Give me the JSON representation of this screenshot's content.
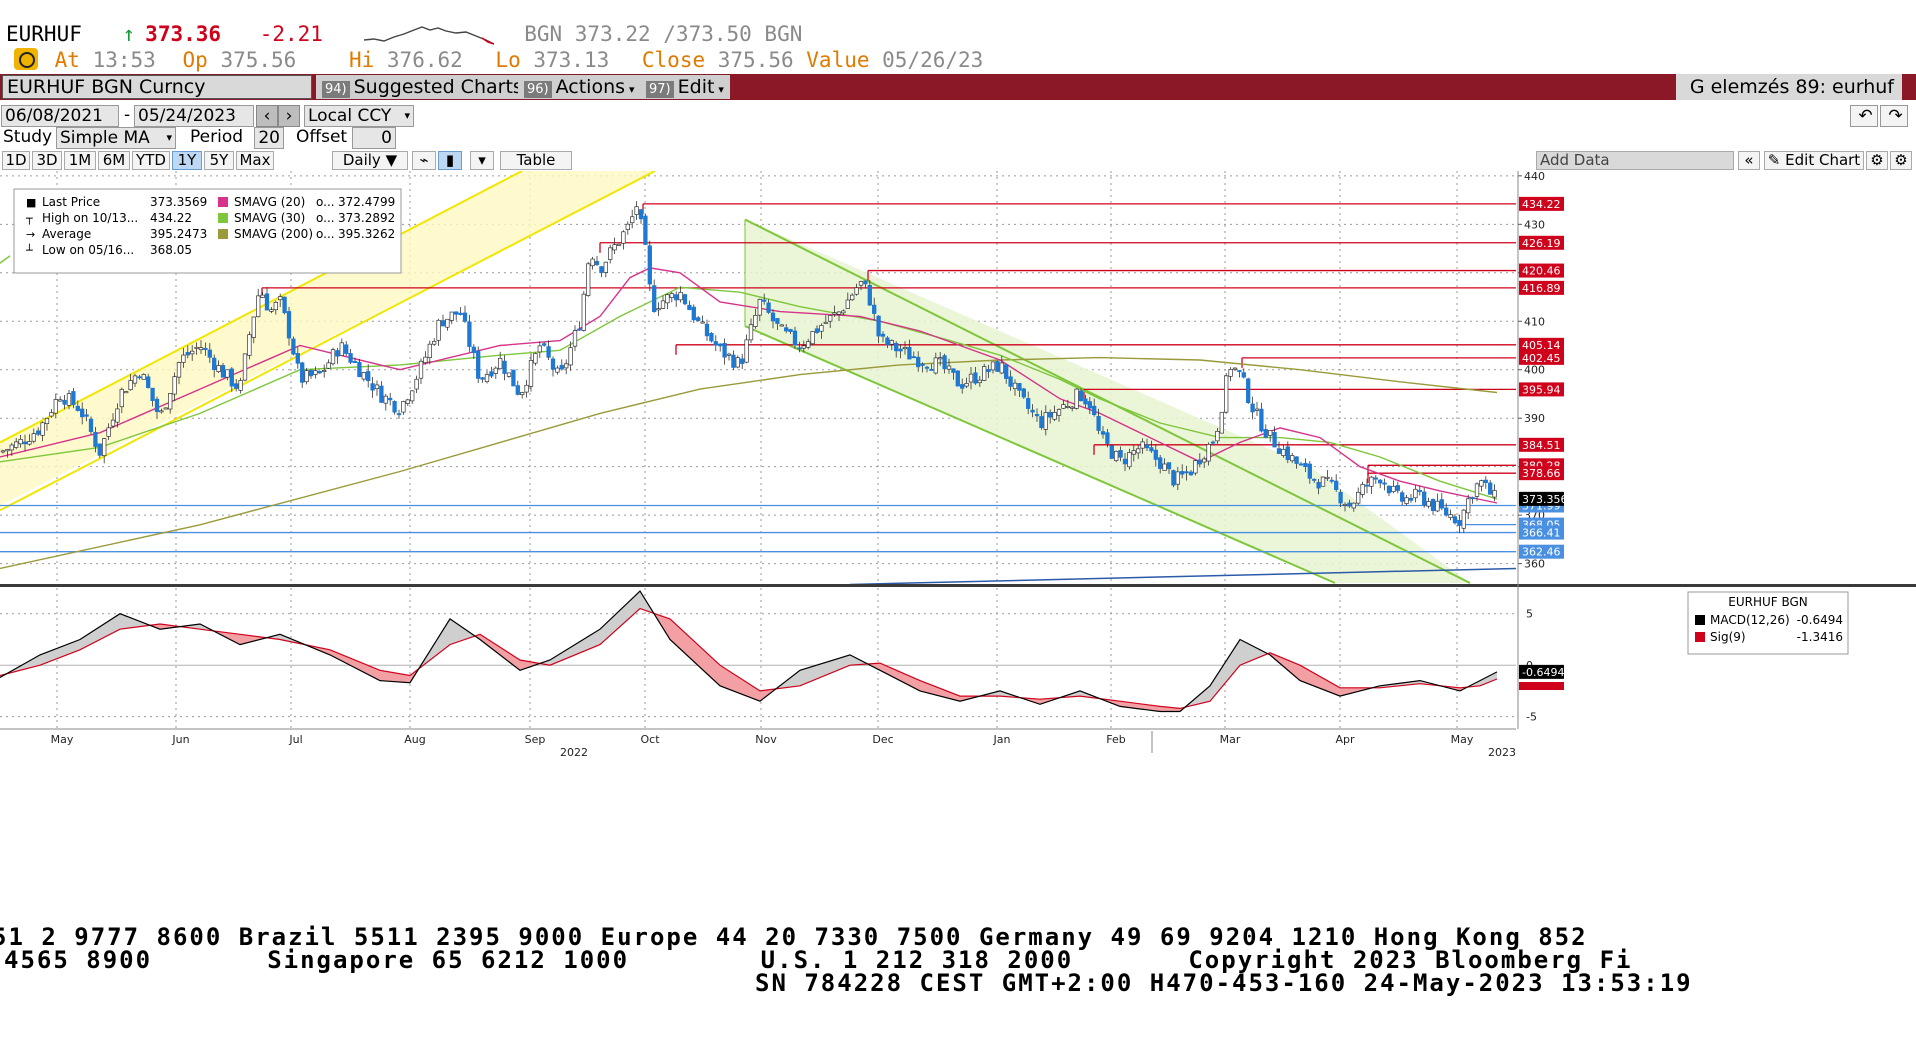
{
  "header": {
    "ticker": "EURHUF",
    "arrow": "↑",
    "last": "373.36",
    "change": "-2.21",
    "bid_ask": "BGN 373.22 /373.50 BGN",
    "at_label": "At",
    "at_time": "13:53",
    "open_label": "Op",
    "open": "375.56",
    "high_label": "Hi",
    "high": "376.62",
    "low_label": "Lo",
    "low": "373.13",
    "close_label": "Close",
    "close": "375.56",
    "value_label": "Value",
    "value_date": "05/26/23"
  },
  "toolbar": {
    "security": "EURHUF BGN Curncy",
    "suggested_num": "94)",
    "suggested": "Suggested Charts",
    "actions_num": "96)",
    "actions": "Actions",
    "edit_num": "97)",
    "edit": "Edit",
    "right_title": "G elemzés 89: eurhuf"
  },
  "controls": {
    "start_date": "06/08/2021",
    "end_date": "05/24/2023",
    "dash": "-",
    "currency": "Local CCY",
    "study_label": "Study",
    "study": "Simple MA",
    "period_label": "Period",
    "period": "20",
    "offset_label": "Offset",
    "offset": "0",
    "ranges": [
      "1D",
      "3D",
      "1M",
      "6M",
      "YTD",
      "1Y",
      "5Y",
      "Max"
    ],
    "selected_range": "1Y",
    "frequency": "Daily",
    "table": "Table",
    "add_data": "Add Data",
    "edit_chart": "Edit Chart"
  },
  "legend": {
    "rows": [
      {
        "label": "Last Price",
        "value": "373.3569"
      },
      {
        "label": "High on 10/13...",
        "value": "434.22"
      },
      {
        "label": "Average",
        "value": "395.2473"
      },
      {
        "label": "Low on 05/16...",
        "value": "368.05"
      }
    ],
    "sma_rows": [
      {
        "label": "SMAVG (20)",
        "mid": "o...",
        "value": "372.4799",
        "color": "#d6338a"
      },
      {
        "label": "SMAVG (30)",
        "mid": "o...",
        "value": "373.2892",
        "color": "#7ec63a"
      },
      {
        "label": "SMAVG (200)",
        "mid": "o...",
        "value": "395.3262",
        "color": "#9a9a3a"
      }
    ]
  },
  "macd_legend": {
    "title": "EURHUF BGN",
    "macd_label": "MACD(12,26)",
    "macd_value": "-0.6494",
    "sig_label": "Sig(9)",
    "sig_value": "-1.3416",
    "last_tag": "-0.6494"
  },
  "chart_data": {
    "type": "candlestick",
    "price_axis": {
      "ylim": [
        356,
        441
      ],
      "ticks": [
        360,
        370,
        380,
        390,
        400,
        410,
        420,
        430,
        440
      ]
    },
    "macd_axis": {
      "ylim": [
        -6.2,
        7.5
      ],
      "ticks": [
        -5,
        0,
        5
      ]
    },
    "x_months": [
      "May",
      "Jun",
      "Jul",
      "Aug",
      "Sep",
      "Oct",
      "Nov",
      "Dec",
      "Jan",
      "Feb",
      "Mar",
      "Apr",
      "May"
    ],
    "year_labels": [
      "2022",
      "2023"
    ],
    "price_path": [
      [
        0,
        383
      ],
      [
        20,
        385
      ],
      [
        40,
        388
      ],
      [
        60,
        395
      ],
      [
        80,
        392
      ],
      [
        100,
        383
      ],
      [
        120,
        395
      ],
      [
        140,
        400
      ],
      [
        160,
        390
      ],
      [
        180,
        402
      ],
      [
        200,
        405
      ],
      [
        220,
        400
      ],
      [
        240,
        396
      ],
      [
        250,
        408
      ],
      [
        260,
        417
      ],
      [
        270,
        412
      ],
      [
        280,
        414
      ],
      [
        290,
        407
      ],
      [
        300,
        398
      ],
      [
        320,
        399
      ],
      [
        340,
        405
      ],
      [
        360,
        400
      ],
      [
        380,
        395
      ],
      [
        400,
        392
      ],
      [
        420,
        400
      ],
      [
        440,
        410
      ],
      [
        460,
        412
      ],
      [
        480,
        398
      ],
      [
        500,
        402
      ],
      [
        520,
        395
      ],
      [
        540,
        405
      ],
      [
        560,
        398
      ],
      [
        580,
        410
      ],
      [
        590,
        425
      ],
      [
        600,
        421
      ],
      [
        620,
        427
      ],
      [
        630,
        430
      ],
      [
        637,
        434.2
      ],
      [
        645,
        425
      ],
      [
        652,
        413
      ],
      [
        660,
        414
      ],
      [
        680,
        416
      ],
      [
        700,
        409
      ],
      [
        720,
        404
      ],
      [
        740,
        401
      ],
      [
        760,
        414
      ],
      [
        780,
        408
      ],
      [
        800,
        405
      ],
      [
        820,
        409
      ],
      [
        840,
        412
      ],
      [
        860,
        418
      ],
      [
        868,
        416
      ],
      [
        880,
        406
      ],
      [
        900,
        404
      ],
      [
        920,
        402
      ],
      [
        940,
        401
      ],
      [
        960,
        397
      ],
      [
        980,
        399
      ],
      [
        1000,
        401
      ],
      [
        1020,
        394
      ],
      [
        1040,
        389
      ],
      [
        1060,
        392
      ],
      [
        1080,
        395
      ],
      [
        1090,
        393
      ],
      [
        1100,
        386
      ],
      [
        1120,
        381
      ],
      [
        1140,
        384
      ],
      [
        1160,
        381
      ],
      [
        1175,
        377
      ],
      [
        1190,
        379
      ],
      [
        1200,
        382
      ],
      [
        1215,
        386
      ],
      [
        1230,
        401
      ],
      [
        1240,
        399
      ],
      [
        1255,
        391
      ],
      [
        1270,
        386
      ],
      [
        1290,
        382
      ],
      [
        1310,
        378
      ],
      [
        1330,
        376
      ],
      [
        1350,
        372
      ],
      [
        1365,
        376
      ],
      [
        1380,
        378
      ],
      [
        1400,
        373
      ],
      [
        1420,
        374
      ],
      [
        1440,
        371
      ],
      [
        1460,
        369
      ],
      [
        1470,
        374
      ],
      [
        1480,
        377
      ],
      [
        1495,
        373.4
      ]
    ],
    "sma20": [
      [
        0,
        382
      ],
      [
        100,
        387
      ],
      [
        200,
        396
      ],
      [
        300,
        405
      ],
      [
        400,
        400
      ],
      [
        500,
        405
      ],
      [
        560,
        406
      ],
      [
        600,
        411
      ],
      [
        630,
        419
      ],
      [
        650,
        421
      ],
      [
        680,
        420
      ],
      [
        720,
        414
      ],
      [
        780,
        412
      ],
      [
        860,
        411
      ],
      [
        920,
        408
      ],
      [
        1000,
        402
      ],
      [
        1060,
        394
      ],
      [
        1100,
        391
      ],
      [
        1150,
        386
      ],
      [
        1200,
        381
      ],
      [
        1240,
        385
      ],
      [
        1280,
        388
      ],
      [
        1320,
        386
      ],
      [
        1360,
        380
      ],
      [
        1400,
        377
      ],
      [
        1440,
        375
      ],
      [
        1497,
        372.5
      ]
    ],
    "sma30": [
      [
        0,
        381
      ],
      [
        100,
        384
      ],
      [
        200,
        391
      ],
      [
        300,
        400
      ],
      [
        400,
        401
      ],
      [
        500,
        403
      ],
      [
        560,
        404
      ],
      [
        620,
        411
      ],
      [
        680,
        417
      ],
      [
        740,
        416
      ],
      [
        800,
        413
      ],
      [
        880,
        410
      ],
      [
        950,
        406
      ],
      [
        1000,
        403
      ],
      [
        1060,
        398
      ],
      [
        1100,
        394
      ],
      [
        1160,
        389
      ],
      [
        1220,
        386
      ],
      [
        1280,
        386
      ],
      [
        1330,
        385
      ],
      [
        1380,
        382
      ],
      [
        1440,
        377
      ],
      [
        1497,
        373.3
      ]
    ],
    "sma200": [
      [
        0,
        359
      ],
      [
        200,
        368
      ],
      [
        400,
        379
      ],
      [
        600,
        391
      ],
      [
        700,
        396
      ],
      [
        800,
        399
      ],
      [
        900,
        401
      ],
      [
        1000,
        402
      ],
      [
        1100,
        402.5
      ],
      [
        1200,
        402
      ],
      [
        1300,
        400
      ],
      [
        1400,
        397.5
      ],
      [
        1497,
        395.3
      ]
    ],
    "macd": [
      [
        0,
        -1.2
      ],
      [
        40,
        1
      ],
      [
        80,
        2.5
      ],
      [
        120,
        5
      ],
      [
        160,
        3.5
      ],
      [
        200,
        4
      ],
      [
        240,
        2
      ],
      [
        280,
        3
      ],
      [
        330,
        1
      ],
      [
        380,
        -1.5
      ],
      [
        410,
        -1.7
      ],
      [
        450,
        4.5
      ],
      [
        480,
        2.5
      ],
      [
        520,
        -0.5
      ],
      [
        550,
        0.5
      ],
      [
        600,
        3.5
      ],
      [
        640,
        7.2
      ],
      [
        670,
        2.5
      ],
      [
        720,
        -2
      ],
      [
        760,
        -3.5
      ],
      [
        800,
        -0.5
      ],
      [
        850,
        1
      ],
      [
        880,
        -0.5
      ],
      [
        920,
        -2.5
      ],
      [
        960,
        -3.5
      ],
      [
        1000,
        -2.5
      ],
      [
        1040,
        -3.8
      ],
      [
        1080,
        -2.5
      ],
      [
        1120,
        -4
      ],
      [
        1160,
        -4.5
      ],
      [
        1180,
        -4.5
      ],
      [
        1210,
        -2
      ],
      [
        1240,
        2.5
      ],
      [
        1270,
        1
      ],
      [
        1300,
        -1.5
      ],
      [
        1340,
        -3
      ],
      [
        1380,
        -2
      ],
      [
        1420,
        -1.5
      ],
      [
        1460,
        -2.5
      ],
      [
        1480,
        -1.5
      ],
      [
        1497,
        -0.65
      ]
    ],
    "signal": [
      [
        0,
        -1
      ],
      [
        40,
        0
      ],
      [
        80,
        1.5
      ],
      [
        120,
        3.5
      ],
      [
        160,
        4
      ],
      [
        200,
        3.5
      ],
      [
        240,
        3
      ],
      [
        280,
        2.5
      ],
      [
        330,
        1.5
      ],
      [
        380,
        -0.5
      ],
      [
        410,
        -1
      ],
      [
        450,
        2
      ],
      [
        480,
        3
      ],
      [
        520,
        0.5
      ],
      [
        550,
        0
      ],
      [
        600,
        2
      ],
      [
        640,
        5.5
      ],
      [
        670,
        4.5
      ],
      [
        720,
        0
      ],
      [
        760,
        -2.5
      ],
      [
        800,
        -2
      ],
      [
        850,
        0
      ],
      [
        880,
        0.2
      ],
      [
        920,
        -1.5
      ],
      [
        960,
        -3
      ],
      [
        1000,
        -3
      ],
      [
        1040,
        -3.3
      ],
      [
        1080,
        -3
      ],
      [
        1120,
        -3.5
      ],
      [
        1160,
        -4
      ],
      [
        1180,
        -4.2
      ],
      [
        1210,
        -3.5
      ],
      [
        1240,
        0
      ],
      [
        1270,
        1.2
      ],
      [
        1300,
        0
      ],
      [
        1340,
        -2.2
      ],
      [
        1380,
        -2.2
      ],
      [
        1420,
        -1.8
      ],
      [
        1460,
        -2.2
      ],
      [
        1480,
        -2
      ],
      [
        1497,
        -1.34
      ]
    ],
    "horizontal_levels": [
      {
        "value": 434.22,
        "label": "434.22",
        "color": "#d0021b",
        "x_from": 643
      },
      {
        "value": 426.19,
        "label": "426.19",
        "color": "#d0021b",
        "x_from": 600
      },
      {
        "value": 420.46,
        "label": "420.46",
        "color": "#d0021b",
        "x_from": 868
      },
      {
        "value": 416.89,
        "label": "416.89",
        "color": "#d0021b",
        "x_from": 262
      },
      {
        "value": 405.14,
        "label": "405.14",
        "color": "#d0021b",
        "x_from": 676
      },
      {
        "value": 402.45,
        "label": "402.45",
        "color": "#d0021b",
        "x_from": 1242
      },
      {
        "value": 395.94,
        "label": "395.94",
        "color": "#d0021b",
        "x_from": 1084
      },
      {
        "value": 384.51,
        "label": "384.51",
        "color": "#d0021b",
        "x_from": 1094
      },
      {
        "value": 380.28,
        "label": "380.28",
        "color": "#d0021b",
        "x_from": 1368
      },
      {
        "value": 378.66,
        "label": "378.66",
        "color": "#d0021b",
        "x_from": 1368
      },
      {
        "value": 371.99,
        "label": "371.99",
        "color": "#4a90e2",
        "x_from": 0
      },
      {
        "value": 368.05,
        "label": "368.05",
        "color": "#4a90e2",
        "x_from": 1465
      },
      {
        "value": 366.41,
        "label": "366.41",
        "color": "#4a90e2",
        "x_from": 0
      },
      {
        "value": 362.46,
        "label": "362.46",
        "color": "#4a90e2",
        "x_from": 0
      }
    ],
    "last_price_tag": "373.3569"
  },
  "tape": {
    "line1": "51 2 9777 8600 Brazil 5511 2395 9000 Europe 44 20 7330 7500 Germany 49 69 9204 1210 Hong Kong 852",
    "line2": "4565 8900       Singapore 65 6212 1000        U.S. 1 212 318 2000       Copyright 2023 Bloomberg Fi",
    "line3": "SN 784228 CEST GMT+2:00 H470-453-160 24-May-2023 13:53:19"
  },
  "colors": {
    "price_up": "#1f78d1",
    "sma20": "#d6338a",
    "sma30": "#7ec63a",
    "sma200": "#9a9a3a",
    "resistance": "#d0021b",
    "support": "#4a90e2",
    "up_channel": "#f2e600",
    "down_channel": "#7ec63a",
    "macd": "#000000",
    "signal": "#d0021b",
    "toolbar_bar": "#8b1826"
  }
}
